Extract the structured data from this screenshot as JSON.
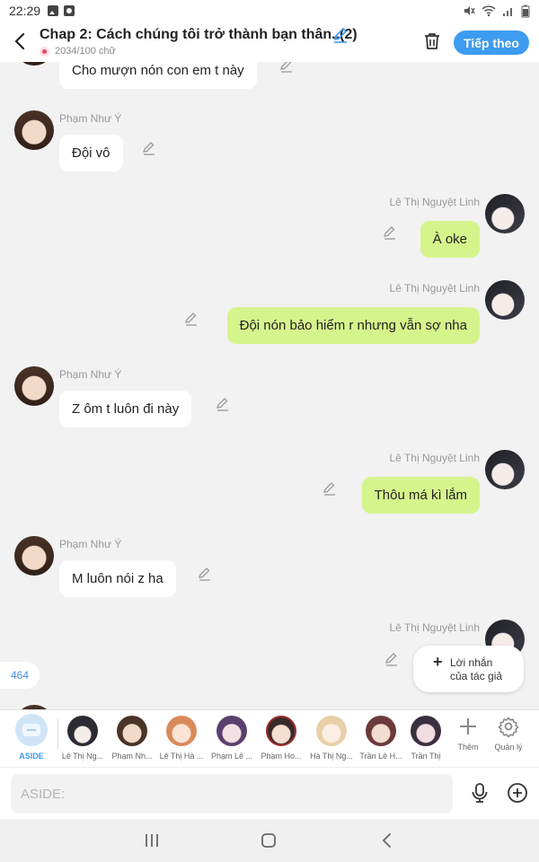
{
  "status": {
    "time": "22:29"
  },
  "header": {
    "title": "Chap 2: Cách chúng tôi trở thành bạn thân..(2)",
    "word_count": "2034/100 chữ",
    "next_label": "Tiếp theo"
  },
  "messages": [
    {
      "side": "left",
      "name": "",
      "text": "Cho mượn nón con em t này"
    },
    {
      "side": "left",
      "name": "Phạm Như Ý",
      "text": "Đội vô"
    },
    {
      "side": "right",
      "name": "Lê Thị Nguyệt Linh",
      "text": "À oke"
    },
    {
      "side": "right",
      "name": "Lê Thị Nguyệt Linh",
      "text": "Đội nón bảo hiểm r nhưng vẫn sợ nha"
    },
    {
      "side": "left",
      "name": "Phạm Như Ý",
      "text": "Z ôm t luôn đi này"
    },
    {
      "side": "right",
      "name": "Lê Thị Nguyệt Linh",
      "text": "Thôu má kì lắm"
    },
    {
      "side": "left",
      "name": "Phạm Như Ý",
      "text": "M luôn nói z ha"
    },
    {
      "side": "right",
      "name": "Lê Thị Nguyệt Linh",
      "text": ""
    }
  ],
  "counter": "464",
  "author_note": {
    "line1": "Lời nhắn",
    "line2": "của tác giả"
  },
  "characters": {
    "aside_label": "ASIDE",
    "items": [
      {
        "label": "Lê Thị Ng...",
        "color": "#2b2b33"
      },
      {
        "label": "Phạm Nh...",
        "color": "#4a3327"
      },
      {
        "label": "Lê Thị Hà ...",
        "color": "#d98a5a"
      },
      {
        "label": "Phạm Lê ...",
        "color": "#5b3f6e"
      },
      {
        "label": "Phạm Ho...",
        "color": "#9c2d2d"
      },
      {
        "label": "Hà Thị Ng...",
        "color": "#e8cfa8"
      },
      {
        "label": "Trần Lê H...",
        "color": "#6b3a3a"
      },
      {
        "label": "Trần Thị",
        "color": "#3a2f3f"
      }
    ],
    "more_label": "Thêm",
    "manage_label": "Quản lý"
  },
  "input": {
    "placeholder": "ASIDE:"
  },
  "colors": {
    "accent": "#3d9bf0",
    "right_bubble": "#d6f48c"
  }
}
